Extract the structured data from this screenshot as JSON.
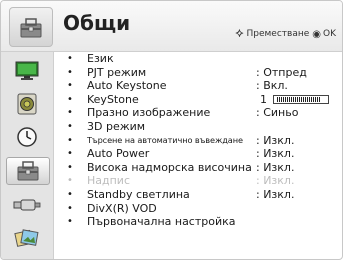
{
  "header": {
    "title": "Общи",
    "hint_move": "Преместване",
    "hint_ok": "OK",
    "icon": "general-settings-icon"
  },
  "sidebar": {
    "items": [
      {
        "icon": "picture-icon",
        "active": false
      },
      {
        "icon": "audio-icon",
        "active": false
      },
      {
        "icon": "clock-icon",
        "active": false
      },
      {
        "icon": "general-settings-icon",
        "active": true
      },
      {
        "icon": "input-icon",
        "active": false
      },
      {
        "icon": "my-media-icon",
        "active": false
      }
    ]
  },
  "menu": {
    "items": [
      {
        "label": "Език",
        "value": ""
      },
      {
        "label": "PJT режим",
        "value": ": Отпред"
      },
      {
        "label": "Auto Keystone",
        "value": ": Вкл."
      },
      {
        "label": "KeyStone",
        "value": "1",
        "level": 0.1
      },
      {
        "label": "Празно изображение",
        "value": ": Синьо"
      },
      {
        "label": "3D режим",
        "value": ""
      },
      {
        "label": "Търсене на автоматично въвеждане",
        "value": ": Изкл."
      },
      {
        "label": "Auto Power",
        "value": ": Изкл."
      },
      {
        "label": "Висока надморска височина",
        "value": ": Изкл."
      },
      {
        "label": "Надпис",
        "value": ": Изкл.",
        "disabled": true
      },
      {
        "label": "Standby светлина",
        "value": ": Изкл."
      },
      {
        "label": "DivX(R) VOD",
        "value": ""
      },
      {
        "label": "Първоначална настройка",
        "value": ""
      }
    ]
  },
  "colors": {
    "sidebar_bg": "#e4e4e4",
    "header_bg": "#efefef",
    "disabled_text": "#bdbdbd"
  }
}
